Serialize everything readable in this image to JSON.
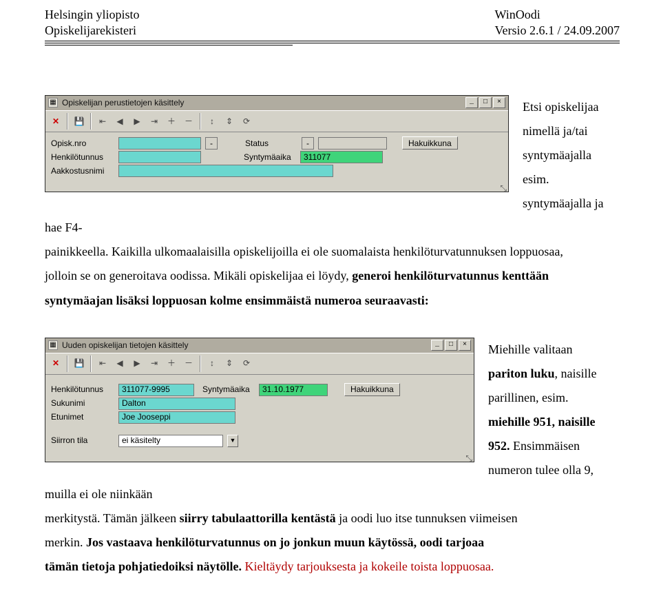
{
  "header": {
    "left_line1": "Helsingin yliopisto",
    "left_line2": "Opiskelijarekisteri",
    "right_line1": "WinOodi",
    "right_line2": "Versio 2.6.1 / 24.09.2007"
  },
  "section1": {
    "window_title": "Opiskelijan perustietojen käsittely",
    "toolbar": {
      "close": "✕",
      "save": "💾",
      "nav_first": "⇤",
      "nav_prev": "◀",
      "nav_next": "▶",
      "nav_last": "⇥",
      "add": "＋",
      "remove": "－",
      "sort1": "↕",
      "sort2": "⇕",
      "refresh": "⟳"
    },
    "labels": {
      "opisk_nro": "Opisk.nro",
      "henkilotunnus": "Henkilötunnus",
      "aakkostusnimi": "Aakkostusnimi",
      "status": "Status",
      "syntymaika": "Syntymäaika",
      "hakuikkuna": "Hakuikkuna"
    },
    "values": {
      "opisk_nro": "",
      "status_flag": "-",
      "status_text": "-",
      "henkilotunnus": "",
      "syntymaika": "311077",
      "aakkostusnimi": ""
    },
    "para_right": {
      "l1": "Etsi opiskelijaa",
      "l2": "nimellä ja/tai",
      "l3": "syntymäajalla",
      "l4": "esim.",
      "l5": "syntymäajalla ja",
      "l6": "hae F4-"
    },
    "para_after": {
      "t1a": "painikkeella. Kaikilla ulkomaalaisilla opiskelijoilla ei ole suomalaista henkilöturvatunnuksen loppuosaa,",
      "t2": "jolloin se on generoitava oodissa. Mikäli opiskelijaa ei löydy, ",
      "t2b": "generoi henkilöturvatunnus kenttään",
      "t3": "syntymäajan lisäksi loppuosan kolme ensimmäistä numeroa seuraavasti:"
    }
  },
  "section2": {
    "window_title": "Uuden opiskelijan tietojen käsittely",
    "labels": {
      "henkilotunnus": "Henkilötunnus",
      "sukunimi": "Sukunimi",
      "etunimet": "Etunimet",
      "syntymaika": "Syntymäaika",
      "hakuikkuna": "Hakuikkuna",
      "siirron_tila": "Siirron tila"
    },
    "values": {
      "henkilotunnus": "311077-9995",
      "syntymaika": "31.10.1977",
      "sukunimi": "Dalton",
      "etunimet": "Joe Jooseppi",
      "siirron_tila": "ei käsitelty"
    },
    "para_right": {
      "l1": "Miehille valitaan",
      "l2a": "pariton luku",
      "l2b": ", naisille",
      "l3": "parillinen, esim.",
      "l4": "miehille 951, naisille",
      "l5a": "952.",
      "l5b": " Ensimmäisen",
      "l6": "numeron tulee olla 9,",
      "l7": "muilla ei ole niinkään"
    },
    "para_after": {
      "t1a": "merkitystä. Tämän jälkeen ",
      "t1b": "siirry tabulaattorilla kentästä",
      "t1c": " ja oodi luo itse tunnuksen viimeisen",
      "t2a": "merkin. ",
      "t2b": "Jos vastaava henkilöturvatunnus on jo jonkun muun käytössä, oodi tarjoaa",
      "t3a": "tämän tietoja pohjatiedoiksi näytölle. ",
      "t3b": "Kieltäydy tarjouksesta ja kokeile toista loppuosaa."
    }
  }
}
